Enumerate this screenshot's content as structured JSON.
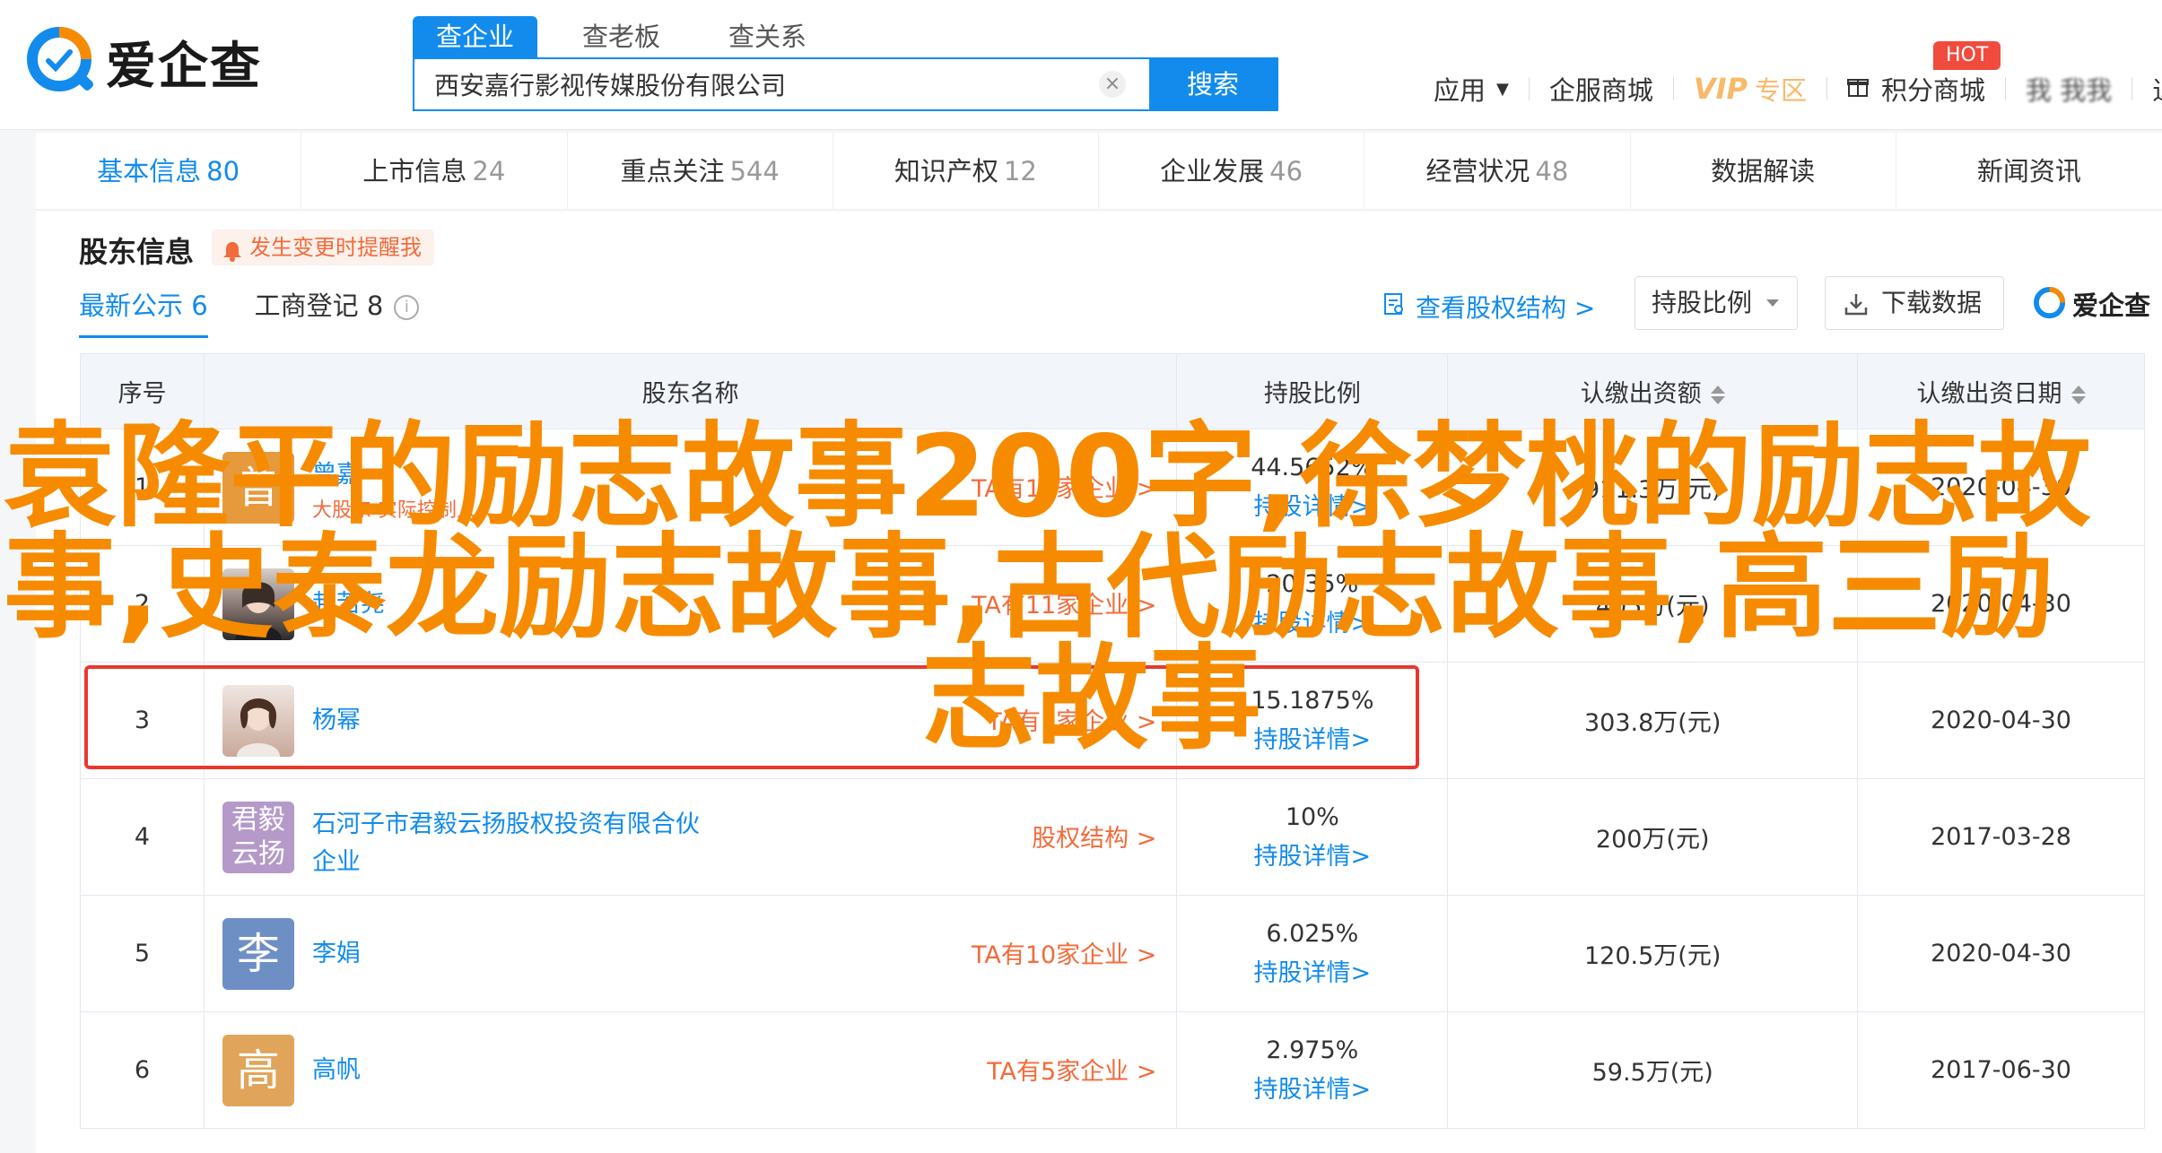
{
  "brand": {
    "name": "爱企查",
    "accent": "#128bed",
    "orange": "#f68b00"
  },
  "search": {
    "tabs": [
      "查企业",
      "查老板",
      "查关系"
    ],
    "query": "西安嘉行影视传媒股份有限公司",
    "button": "搜索",
    "clear_icon": "close-icon"
  },
  "top_nav": {
    "app": "应用",
    "service": "企服商城",
    "vip": "VIP",
    "vip_sub": "专区",
    "points": "积分商城",
    "hot": "HOT",
    "user": "我 我我",
    "exit": "退出"
  },
  "tabs": [
    {
      "label": "基本信息",
      "count": "80"
    },
    {
      "label": "上市信息",
      "count": "24"
    },
    {
      "label": "重点关注",
      "count": "544"
    },
    {
      "label": "知识产权",
      "count": "12"
    },
    {
      "label": "企业发展",
      "count": "46"
    },
    {
      "label": "经营状况",
      "count": "48"
    },
    {
      "label": "数据解读",
      "count": ""
    },
    {
      "label": "新闻资讯",
      "count": ""
    }
  ],
  "section": {
    "title": "股东信息",
    "alert": "发生变更时提醒我",
    "subtabs": [
      "最新公示 6",
      "工商登记 8"
    ],
    "view_struct": "查看股权结构 >",
    "ratio_select": "持股比例",
    "download": "下载数据",
    "mini_logo": "爱企查"
  },
  "table": {
    "headers": [
      "序号",
      "股东名称",
      "持股比例",
      "认缴出资额",
      "认缴出资日期"
    ],
    "detail_label": "持股详情>",
    "rows": [
      {
        "no": "1",
        "name": "曾嘉",
        "sub": "大股东·实际控制人",
        "link": "TA有10家企业 >",
        "pct": "44.5652%",
        "amount": "911.3万(元)",
        "date": "2020-04-30",
        "avatar_text": "曾",
        "avatar_color": "#e69a3c"
      },
      {
        "no": "2",
        "name": "赵若尧",
        "sub": "",
        "link": "TA有11家企业 >",
        "pct": "20.35%",
        "amount": "405万(元)",
        "date": "2020-04-30",
        "avatar_text": "",
        "avatar_color": "#7a6a66"
      },
      {
        "no": "3",
        "name": "杨幂",
        "sub": "",
        "link": "TA有1家企业 >",
        "pct": "15.1875%",
        "amount": "303.8万(元)",
        "date": "2020-04-30",
        "avatar_text": "",
        "avatar_color": "#b58b7a"
      },
      {
        "no": "4",
        "name": "石河子市君毅云扬股权投资有限合伙企业",
        "sub": "",
        "link": "股权结构 >",
        "pct": "10%",
        "amount": "200万(元)",
        "date": "2017-03-28",
        "avatar_text": "君毅云扬",
        "avatar_color": "#b59ac9"
      },
      {
        "no": "5",
        "name": "李娟",
        "sub": "",
        "link": "TA有10家企业 >",
        "pct": "6.025%",
        "amount": "120.5万(元)",
        "date": "2020-04-30",
        "avatar_text": "李",
        "avatar_color": "#6e8fc4"
      },
      {
        "no": "6",
        "name": "高帆",
        "sub": "",
        "link": "TA有5家企业 >",
        "pct": "2.975%",
        "amount": "59.5万(元)",
        "date": "2017-06-30",
        "avatar_text": "高",
        "avatar_color": "#e0a55a"
      }
    ]
  },
  "overlay": {
    "line1": "袁隆平的励志故事200字,徐梦桃的励志故",
    "line2": "事,史泰龙励志故事,古代励志故事,高三励",
    "line3": "志故事"
  }
}
